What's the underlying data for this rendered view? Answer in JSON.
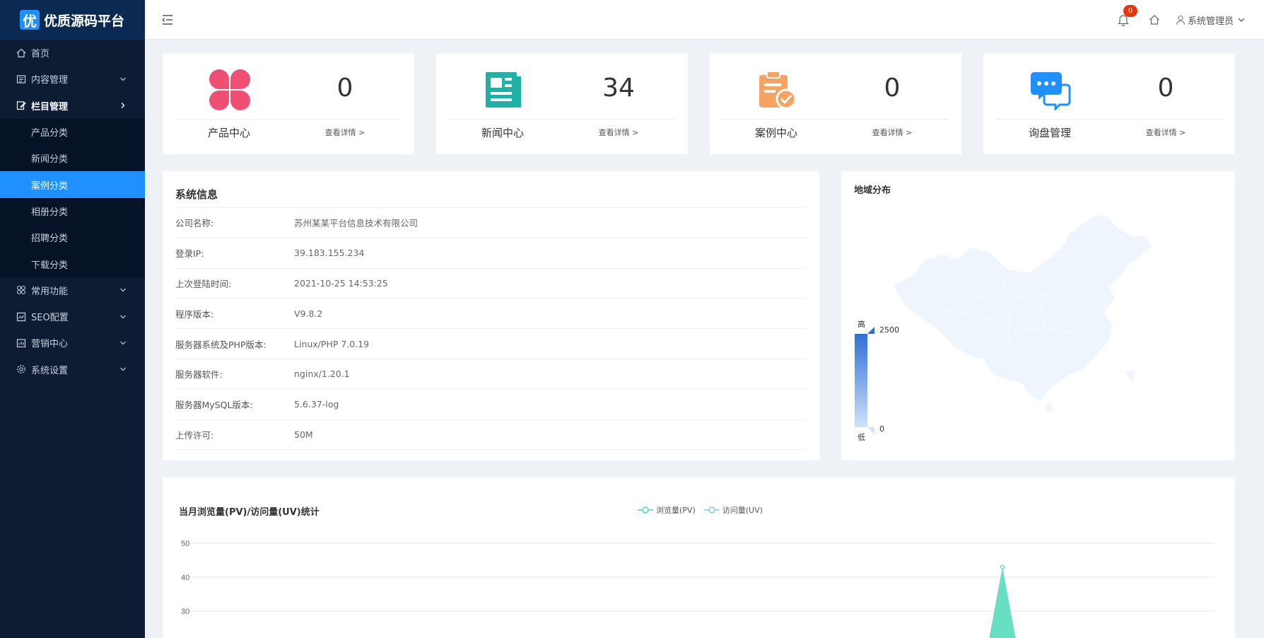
{
  "brand": {
    "mark": "优",
    "name": "优质源码平台"
  },
  "sidebar": {
    "items": [
      {
        "label": "首页",
        "icon": "home-icon"
      },
      {
        "label": "内容管理",
        "icon": "document-icon"
      },
      {
        "label": "栏目管理",
        "icon": "edit-icon"
      }
    ],
    "sub_items": [
      "产品分类",
      "新闻分类",
      "案例分类",
      "相册分类",
      "招聘分类",
      "下载分类"
    ],
    "active_sub": "案例分类",
    "lower_items": [
      {
        "label": "常用功能",
        "icon": "grid-icon"
      },
      {
        "label": "SEO配置",
        "icon": "seo-icon"
      },
      {
        "label": "营销中心",
        "icon": "marketing-icon"
      },
      {
        "label": "系统设置",
        "icon": "gear-icon"
      }
    ]
  },
  "header": {
    "notification_count": "0",
    "user_name": "系统管理员"
  },
  "cards": [
    {
      "title": "产品中心",
      "value": "0",
      "link": "查看详情 >",
      "color": "#ee4f72",
      "icon": "clover-icon"
    },
    {
      "title": "新闻中心",
      "value": "34",
      "link": "查看详情 >",
      "color": "#1fb0a6",
      "icon": "newspaper-icon"
    },
    {
      "title": "案例中心",
      "value": "0",
      "link": "查看详情 >",
      "color": "#f6a262",
      "icon": "clipboard-check-icon"
    },
    {
      "title": "询盘管理",
      "value": "0",
      "link": "查看详情 >",
      "color": "#1e90ff",
      "icon": "chat-bubbles-icon"
    }
  ],
  "sysinfo": {
    "title": "系统信息",
    "rows": [
      {
        "k": "公司名称:",
        "v": "苏州某某平台信息技术有限公司"
      },
      {
        "k": "登录IP:",
        "v": "39.183.155.234"
      },
      {
        "k": "上次登陆时间:",
        "v": "2021-10-25 14:53:25"
      },
      {
        "k": "程序版本:",
        "v": "V9.8.2"
      },
      {
        "k": "服务器系统及PHP版本:",
        "v": "Linux/PHP 7.0.19"
      },
      {
        "k": "服务器软件:",
        "v": "nginx/1.20.1"
      },
      {
        "k": "服务器MySQL版本:",
        "v": "5.6.37-log"
      },
      {
        "k": "上传许可:",
        "v": "50M"
      }
    ]
  },
  "region": {
    "title": "地域分布",
    "legend_high": "高",
    "legend_low": "低",
    "max": "2500",
    "min": "0"
  },
  "chart_data": {
    "type": "area",
    "title": "当月浏览量(PV)/访问量(UV)统计",
    "ylim": [
      0,
      50
    ],
    "yticks": [
      30,
      40,
      50
    ],
    "series": [
      {
        "name": "浏览量(PV)",
        "color": "#4dd8b8"
      },
      {
        "name": "访问量(UV)",
        "color": "#7ec8e3"
      }
    ],
    "peak": {
      "value": 43
    }
  }
}
